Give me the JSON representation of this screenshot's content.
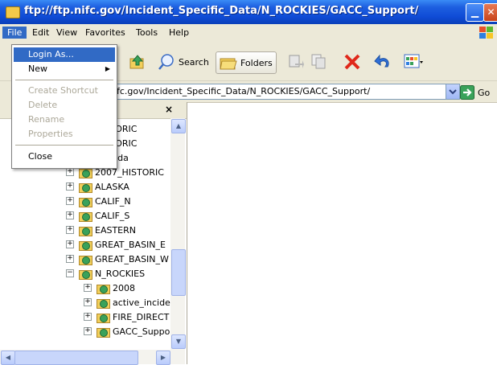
{
  "window": {
    "title": "ftp://ftp.nifc.gov/Incident_Specific_Data/N_ROCKIES/GACC_Support/",
    "minimize_icon": "minimize-icon",
    "close_icon": "close-icon"
  },
  "menubar": {
    "items": [
      "File",
      "Edit",
      "View",
      "Favorites",
      "Tools",
      "Help"
    ]
  },
  "toolbar": {
    "search_label": "Search",
    "folders_label": "Folders"
  },
  "address": {
    "value": "fc.gov/Incident_Specific_Data/N_ROCKIES/GACC_Support/",
    "go_label": "Go"
  },
  "file_menu": {
    "items": [
      {
        "label": "Login As...",
        "state": "highlighted"
      },
      {
        "label": "New",
        "state": "submenu"
      },
      {
        "label": "Create Shortcut",
        "state": "disabled"
      },
      {
        "label": "Delete",
        "state": "disabled"
      },
      {
        "label": "Rename",
        "state": "disabled"
      },
      {
        "label": "Properties",
        "state": "disabled"
      },
      {
        "label": "Close",
        "state": "normal"
      }
    ]
  },
  "folders_pane": {
    "close_label": "×",
    "tree": [
      {
        "label": "HISTORIC",
        "level": 1,
        "expander": "+"
      },
      {
        "label": "HISTORIC",
        "level": 1,
        "expander": "+"
      },
      {
        "label": "Canada",
        "level": 1,
        "expander": "+"
      },
      {
        "label": "2007_HISTORIC",
        "level": 1,
        "expander": "+"
      },
      {
        "label": "ALASKA",
        "level": 1,
        "expander": "+"
      },
      {
        "label": "CALIF_N",
        "level": 1,
        "expander": "+"
      },
      {
        "label": "CALIF_S",
        "level": 1,
        "expander": "+"
      },
      {
        "label": "EASTERN",
        "level": 1,
        "expander": "+"
      },
      {
        "label": "GREAT_BASIN_E",
        "level": 1,
        "expander": "+"
      },
      {
        "label": "GREAT_BASIN_W",
        "level": 1,
        "expander": "+"
      },
      {
        "label": "N_ROCKIES",
        "level": 1,
        "expander": "−"
      },
      {
        "label": "2008",
        "level": 2,
        "expander": "+"
      },
      {
        "label": "active_incider",
        "level": 2,
        "expander": "+"
      },
      {
        "label": "FIRE_DIRECT",
        "level": 2,
        "expander": "+"
      },
      {
        "label": "GACC_Suppo",
        "level": 2,
        "expander": "+"
      }
    ]
  },
  "colors": {
    "title_blue": "#0f4bd6",
    "highlight": "#316ac5",
    "chrome": "#ece9d8"
  }
}
